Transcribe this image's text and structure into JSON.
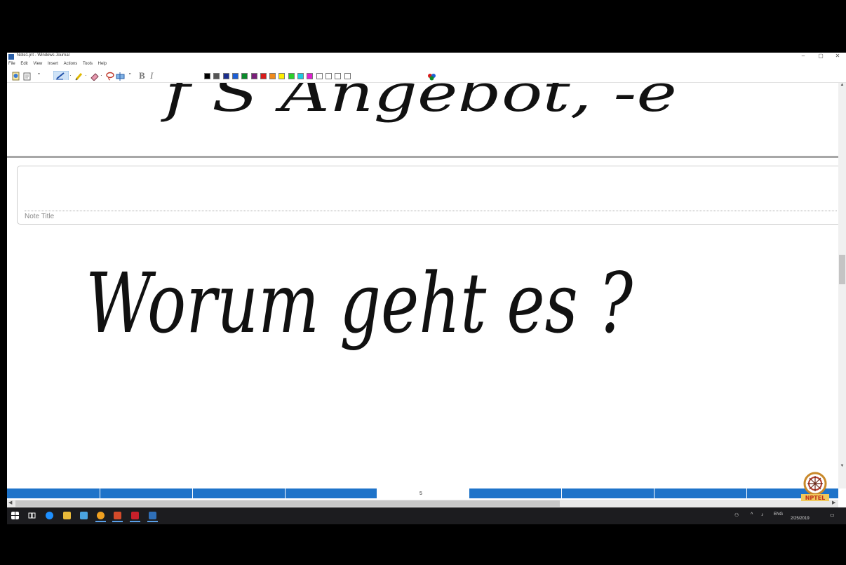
{
  "window": {
    "title": "Note1.jnt - Windows Journal",
    "minimize": "–",
    "maximize": "▢",
    "close": "✕"
  },
  "menu": [
    "File",
    "Edit",
    "View",
    "Insert",
    "Actions",
    "Tools",
    "Help"
  ],
  "toolbar": {
    "bold": "B",
    "italic": "I",
    "colors": [
      "#000000",
      "#555555",
      "#1c2f8f",
      "#1d5fd6",
      "#0a8a2a",
      "#7a1f7a",
      "#d81b1b",
      "#f08a1c",
      "#ffee00",
      "#2ad12a",
      "#1ec8e0",
      "#e020d0",
      "#ffffff",
      "#ffffff",
      "#ffffff",
      "#ffffff"
    ]
  },
  "note": {
    "title_placeholder": "Note Title",
    "page_number": "5"
  },
  "handwriting": {
    "previous_page": "f S Angebot, -e",
    "current_page": "Worum geht es ?"
  },
  "taskbar": {
    "language": "ENG",
    "date": "2/25/2019",
    "logo_text": "NPTEL"
  }
}
